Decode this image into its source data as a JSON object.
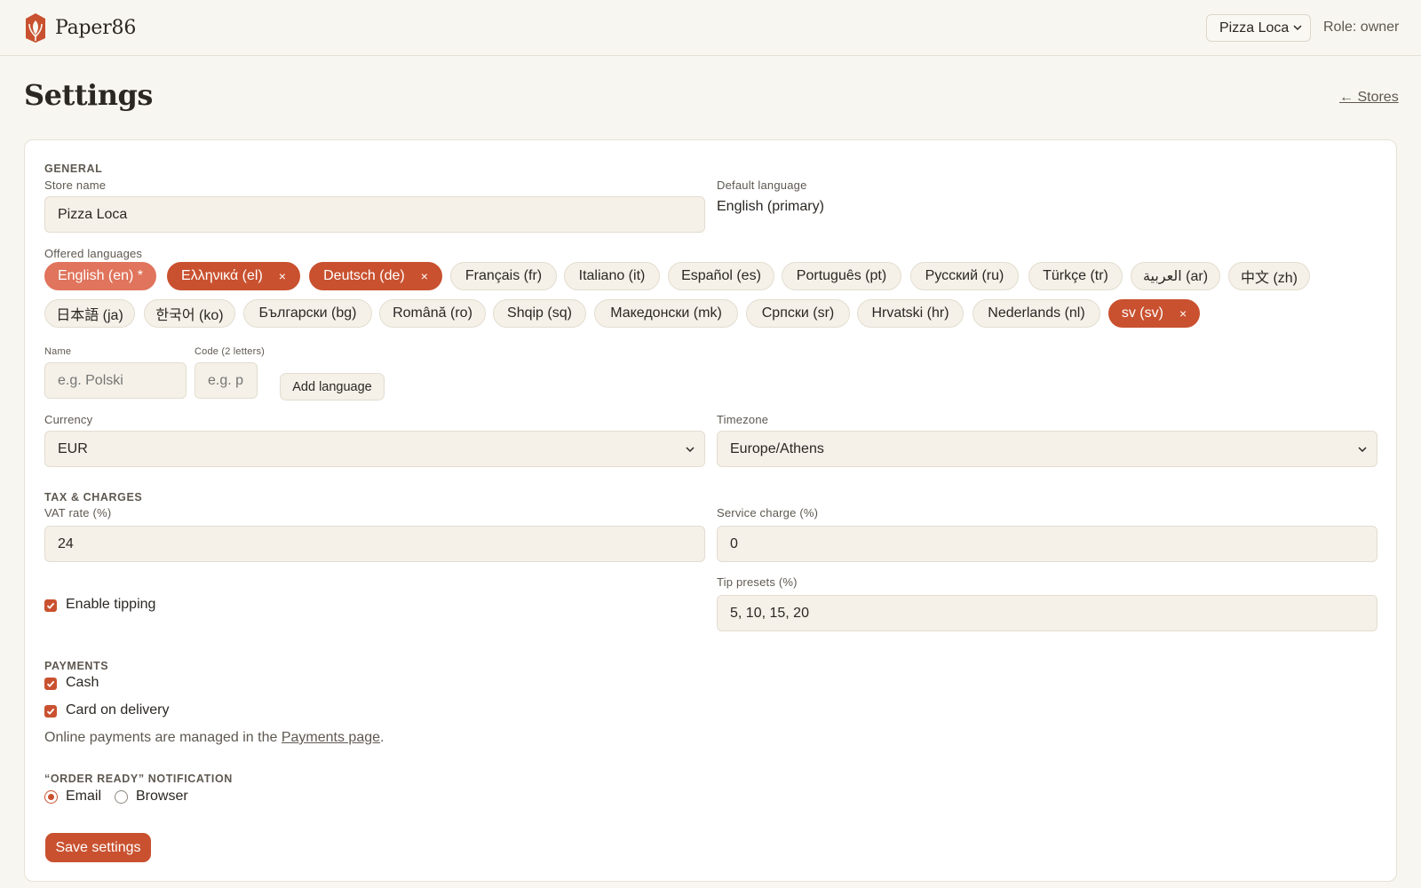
{
  "header": {
    "brand_name": "Paper86",
    "store_selector": "Pizza Loca",
    "role": "Role: owner"
  },
  "page": {
    "title": "Settings",
    "back_link": "← Stores"
  },
  "general": {
    "section": "GENERAL",
    "store_name_label": "Store name",
    "store_name_value": "Pizza Loca",
    "default_language_label": "Default language",
    "default_language_value": "English (primary)",
    "offered_languages_label": "Offered languages",
    "languages": [
      {
        "label": "English (en) *",
        "state": "primary"
      },
      {
        "label": "Ελληνικά (el)",
        "state": "selected",
        "remove": "×"
      },
      {
        "label": "Deutsch (de)",
        "state": "selected",
        "remove": "×"
      },
      {
        "label": "Français (fr)",
        "state": "off"
      },
      {
        "label": "Italiano (it)",
        "state": "off"
      },
      {
        "label": "Español (es)",
        "state": "off"
      },
      {
        "label": "Português (pt)",
        "state": "off"
      },
      {
        "label": "Русский (ru)",
        "state": "off"
      },
      {
        "label": "Türkçe (tr)",
        "state": "off"
      },
      {
        "label": "العربية (ar)",
        "state": "off"
      },
      {
        "label": "中文 (zh)",
        "state": "off"
      },
      {
        "label": "日本語 (ja)",
        "state": "off"
      },
      {
        "label": "한국어 (ko)",
        "state": "off"
      },
      {
        "label": "Български (bg)",
        "state": "off"
      },
      {
        "label": "Română (ro)",
        "state": "off"
      },
      {
        "label": "Shqip (sq)",
        "state": "off"
      },
      {
        "label": "Македонски (mk)",
        "state": "off"
      },
      {
        "label": "Српски (sr)",
        "state": "off"
      },
      {
        "label": "Hrvatski (hr)",
        "state": "off"
      },
      {
        "label": "Nederlands (nl)",
        "state": "off"
      },
      {
        "label": "sv (sv)",
        "state": "selected",
        "remove": "×"
      }
    ],
    "new_lang_name_label": "Name",
    "new_lang_name_placeholder": "e.g. Polski",
    "new_lang_code_label": "Code (2 letters)",
    "new_lang_code_placeholder": "e.g. pl",
    "add_language_button": "Add language",
    "currency_label": "Currency",
    "currency_value": "EUR",
    "timezone_label": "Timezone",
    "timezone_value": "Europe/Athens"
  },
  "tax": {
    "section": "TAX & CHARGES",
    "vat_label": "VAT rate (%)",
    "vat_value": "24",
    "service_label": "Service charge (%)",
    "service_value": "0",
    "tip_presets_label": "Tip presets (%)",
    "tip_presets_value": "5, 10, 15, 20",
    "enable_tipping_label": "Enable tipping",
    "enable_tipping_checked": true
  },
  "payments": {
    "section": "PAYMENTS",
    "cash_label": "Cash",
    "card_label": "Card on delivery",
    "note_prefix": "Online payments are managed in the ",
    "note_link": "Payments page",
    "note_suffix": "."
  },
  "notification": {
    "section": "“ORDER READY” NOTIFICATION",
    "email_label": "Email",
    "browser_label": "Browser",
    "selected": "Email"
  },
  "actions": {
    "save_button": "Save settings"
  },
  "colors": {
    "accent": "#c9512f",
    "accent_light": "#e0745c",
    "background": "#f8f6f0",
    "input_bg": "#f5f1e8"
  }
}
